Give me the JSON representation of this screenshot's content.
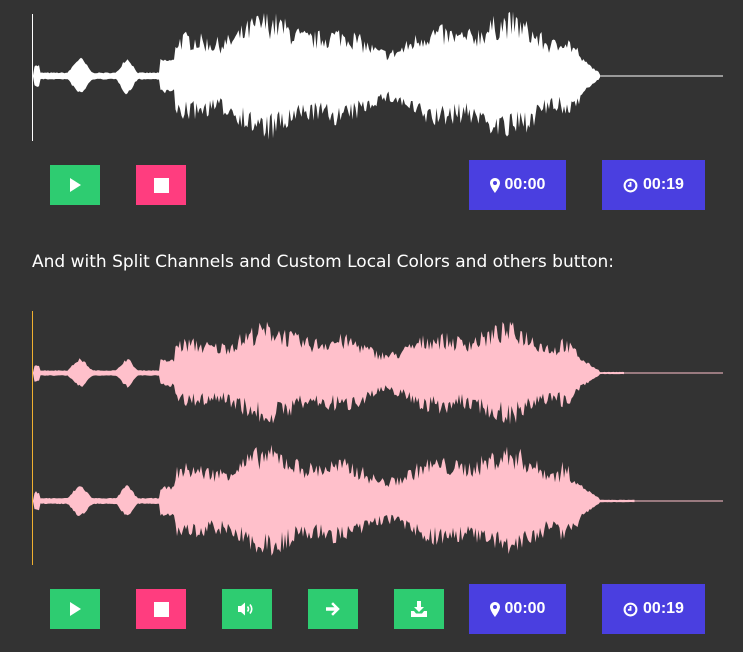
{
  "player1": {
    "wave_color": "#ffffff",
    "cursor_color": "#ffffff",
    "controls": [
      {
        "name": "play-button",
        "icon": "play-icon",
        "color": "#2ecc71"
      },
      {
        "name": "stop-button",
        "icon": "stop-icon",
        "color": "#ff3d7f"
      }
    ],
    "current_time": "00:00",
    "current_time_icon": "map-marker-icon",
    "duration": "00:19",
    "duration_icon": "clock-icon"
  },
  "caption": "And with Split Channels and Custom Local Colors and others button:",
  "player2": {
    "wave_color": "#ffc0cb",
    "cursor_color": "#f0b030",
    "channels": 2,
    "controls": [
      {
        "name": "play-button",
        "icon": "play-icon",
        "color": "#2ecc71"
      },
      {
        "name": "stop-button",
        "icon": "stop-icon",
        "color": "#ff3d7f"
      },
      {
        "name": "volume-button",
        "icon": "volume-icon",
        "color": "#2ecc71"
      },
      {
        "name": "skip-forward-button",
        "icon": "arrow-right-icon",
        "color": "#2ecc71"
      },
      {
        "name": "download-button",
        "icon": "download-icon",
        "color": "#2ecc71"
      }
    ],
    "current_time": "00:00",
    "current_time_icon": "map-marker-icon",
    "duration": "00:19",
    "duration_icon": "clock-icon"
  }
}
